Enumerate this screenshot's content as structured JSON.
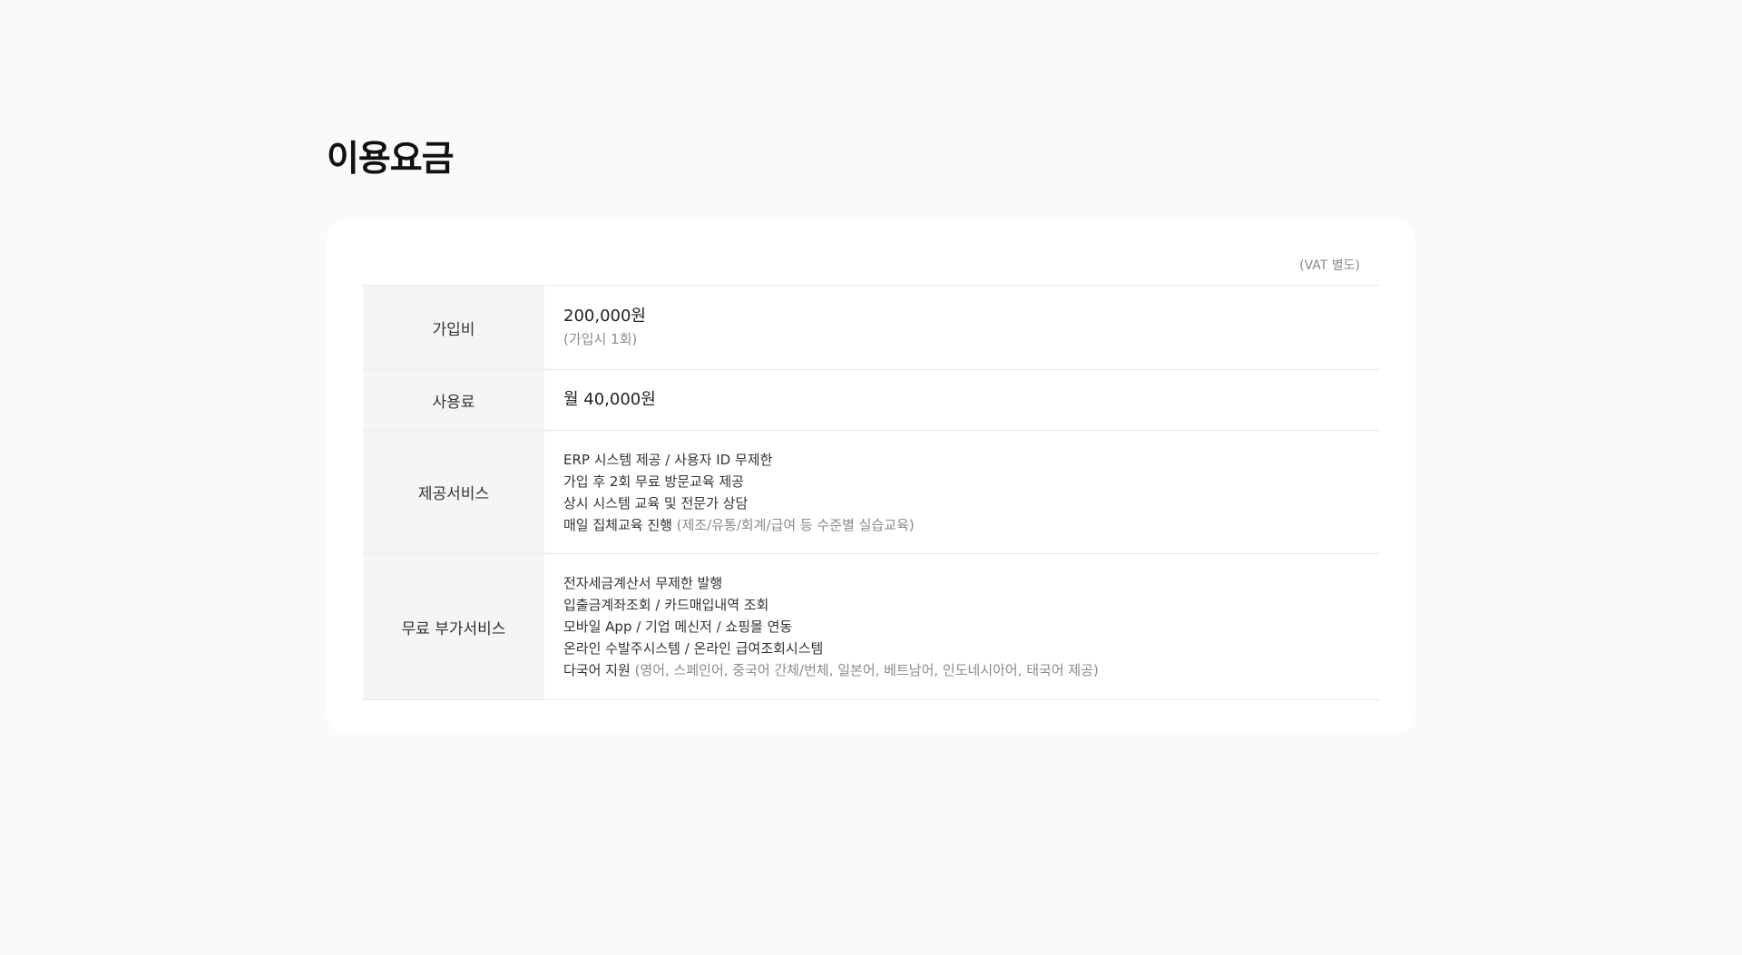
{
  "page": {
    "title": "이용요금",
    "vat_note": "(VAT 별도)"
  },
  "pricing": {
    "signup": {
      "label": "가입비",
      "price": "200,000원",
      "note": "(가입시 1회)"
    },
    "usage": {
      "label": "사용료",
      "price": "월 40,000원"
    },
    "services": {
      "label": "제공서비스",
      "items": [
        {
          "text": "ERP 시스템 제공 / 사용자 ID 무제한",
          "note": ""
        },
        {
          "text": "가입 후 2회 무료 방문교육 제공",
          "note": ""
        },
        {
          "text": "상시 시스템 교육 및 전문가 상담",
          "note": ""
        },
        {
          "text": "매일 집체교육 진행",
          "note": "(제조/유통/회계/급여 등 수준별 실습교육)"
        }
      ]
    },
    "extras": {
      "label": "무료 부가서비스",
      "items": [
        {
          "text": "전자세금계산서 무제한 발행",
          "note": ""
        },
        {
          "text": "입출금계좌조회 / 카드매입내역 조회",
          "note": ""
        },
        {
          "text": "모바일 App / 기업 메신저 / 쇼핑몰 연동",
          "note": ""
        },
        {
          "text": "온라인 수발주시스템 / 온라인 급여조회시스템",
          "note": ""
        },
        {
          "text": "다국어 지원",
          "note": "(영어, 스페인어, 중국어 간체/번체, 일본어, 베트남어, 인도네시아어, 태국어 제공)"
        }
      ]
    }
  }
}
